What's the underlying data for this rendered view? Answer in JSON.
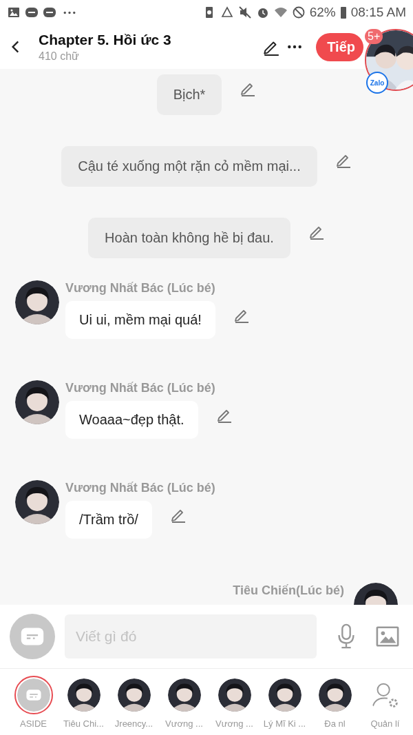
{
  "status_bar": {
    "battery": "62%",
    "time": "08:15 AM"
  },
  "header": {
    "title": "Chapter 5. Hồi ức 3",
    "subtitle": "410 chữ",
    "next_button": "Tiếp"
  },
  "chat_head": {
    "badge": "5+",
    "logo": "Zalo"
  },
  "messages": [
    {
      "kind": "narration",
      "text": "Bịch*"
    },
    {
      "kind": "narration",
      "text": "Cậu té xuống một rặn cỏ mềm mại..."
    },
    {
      "kind": "narration",
      "text": "Hoàn toàn không hề bị đau."
    },
    {
      "kind": "character",
      "name": "Vương Nhất Bác (Lúc bé)",
      "text": "Ui ui, mềm mại quá!"
    },
    {
      "kind": "character",
      "name": "Vương Nhất Bác (Lúc bé)",
      "text": "Woaaa~đẹp thật."
    },
    {
      "kind": "character",
      "name": "Vương Nhất Bác (Lúc bé)",
      "text": "/Trầm trồ/"
    },
    {
      "kind": "character_right",
      "name": "Tiêu Chiến(Lúc bé)"
    }
  ],
  "composer": {
    "placeholder": "Viết gì đó"
  },
  "characters": [
    {
      "kind": "aside",
      "label": "ASIDE",
      "selected": true
    },
    {
      "kind": "avatar",
      "label": "Tiêu Chi...",
      "selected": false
    },
    {
      "kind": "avatar",
      "label": "Jreency...",
      "selected": false
    },
    {
      "kind": "avatar",
      "label": "Vương ...",
      "selected": false
    },
    {
      "kind": "avatar",
      "label": "Vương ...",
      "selected": false
    },
    {
      "kind": "avatar",
      "label": "Lý Mĩ Ki ...",
      "selected": false
    },
    {
      "kind": "avatar",
      "label": "Đa nl",
      "selected": false
    },
    {
      "kind": "manage",
      "label": "Quản lí",
      "selected": false
    }
  ]
}
